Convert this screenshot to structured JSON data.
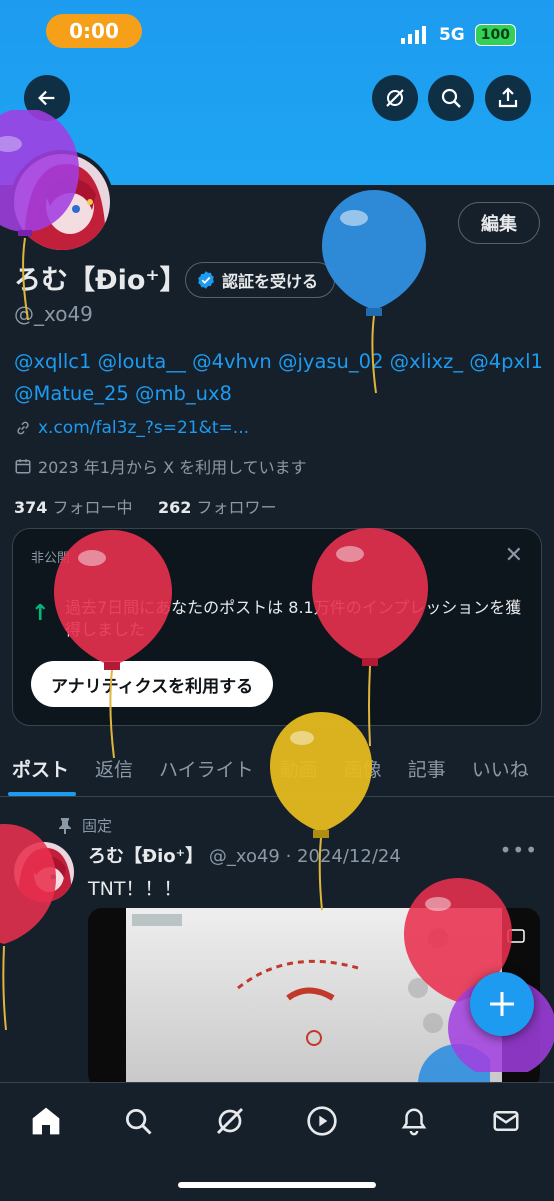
{
  "status_bar": {
    "time": "0:00",
    "network": "5G",
    "battery": "100"
  },
  "profile": {
    "name": "ろむ【Đio⁺】",
    "handle": "@_xo49",
    "verify_label": "認証を受ける",
    "edit_label": "編集",
    "bio": "@xqllc1 @louta__ @4vhvn @jyasu_02 @xlixz_ @4pxl1 @Matue_25 @mb_ux8",
    "link": "x.com/fal3z_?s=21&t=...",
    "joined": "2023 年1月から X を利用しています",
    "following_count": "374",
    "following_label": "フォロー中",
    "followers_count": "262",
    "followers_label": "フォロワー"
  },
  "card": {
    "label": "非公開",
    "message": "過去7日間にあなたのポストは 8.1万件のインプレッションを獲得しました",
    "button": "アナリティクスを利用する"
  },
  "tabs": [
    "ポスト",
    "返信",
    "ハイライト",
    "動画",
    "画像",
    "記事",
    "いいね"
  ],
  "post": {
    "pinned_label": "固定",
    "name": "ろむ【Đio⁺】",
    "handle_date": "@_xo49 · 2024/12/24",
    "text": "TNT！！！"
  },
  "colors": {
    "accent": "#1d9bf0",
    "background": "#15202b",
    "muted": "#8b98a5"
  },
  "icons": {
    "back": "arrow-left-icon",
    "grok": "grok-icon",
    "search": "search-icon",
    "share": "share-icon",
    "home": "home-icon",
    "explore": "search-icon",
    "grok_nav": "grok-icon",
    "video": "play-icon",
    "notifications": "bell-icon",
    "messages": "mail-icon",
    "compose": "plus-icon"
  }
}
